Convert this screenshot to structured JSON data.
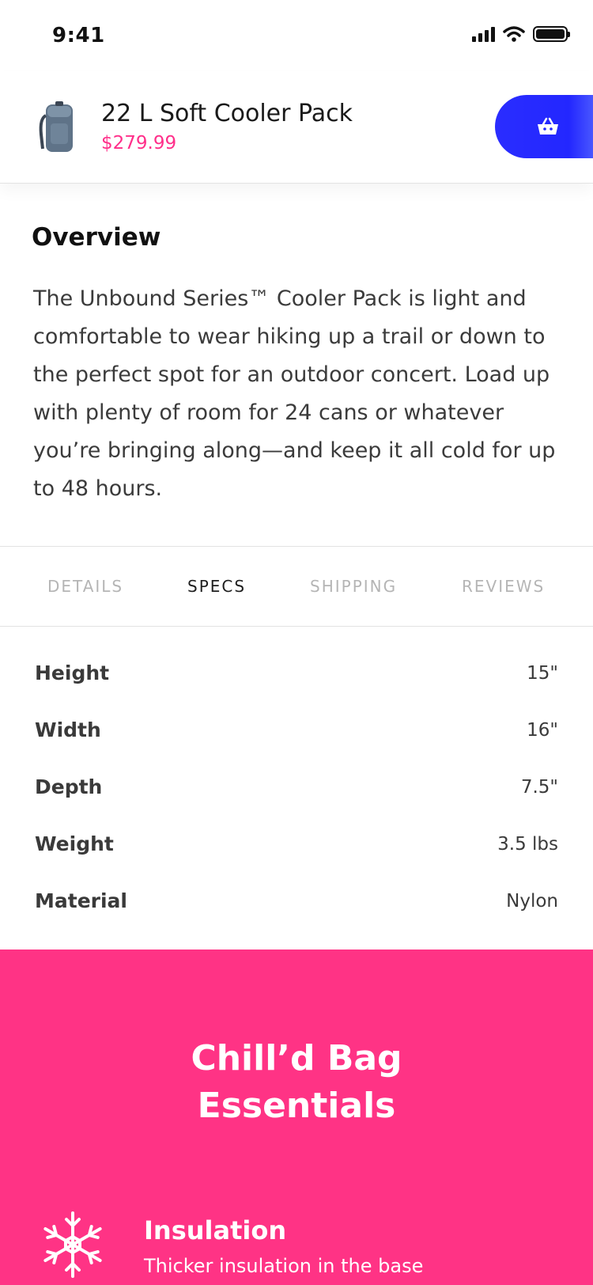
{
  "status_bar": {
    "time": "9:41"
  },
  "product": {
    "title": "22 L Soft Cooler Pack",
    "price": "$279.99",
    "thumbnail_icon": "cooler-backpack-thumbnail",
    "cart_icon": "basket-icon"
  },
  "overview": {
    "heading": "Overview",
    "body": "The Unbound Series™ Cooler Pack is light and comfortable to wear hiking up a trail or down to the perfect spot for an outdoor concert. Load up with plenty of room for 24 cans or whatever you’re bringing along—and keep it all cold for up to 48 hours."
  },
  "tabs": [
    {
      "label": "DETAILS",
      "active": false
    },
    {
      "label": "SPECS",
      "active": true
    },
    {
      "label": "SHIPPING",
      "active": false
    },
    {
      "label": "REVIEWS",
      "active": false
    }
  ],
  "specs": [
    {
      "label": "Height",
      "value": "15\""
    },
    {
      "label": "Width",
      "value": "16\""
    },
    {
      "label": "Depth",
      "value": "7.5\""
    },
    {
      "label": "Weight",
      "value": "3.5 lbs"
    },
    {
      "label": "Material",
      "value": "Nylon"
    }
  ],
  "essentials": {
    "title_line1": "Chill’d Bag",
    "title_line2": "Essentials",
    "features": [
      {
        "icon": "snowflake-icon",
        "title": "Insulation",
        "description": "Thicker insulation in the base"
      }
    ]
  },
  "colors": {
    "accent_pink": "#ff3385",
    "price_pink": "#ff2f8a",
    "cart_blue": "#2327ff"
  }
}
